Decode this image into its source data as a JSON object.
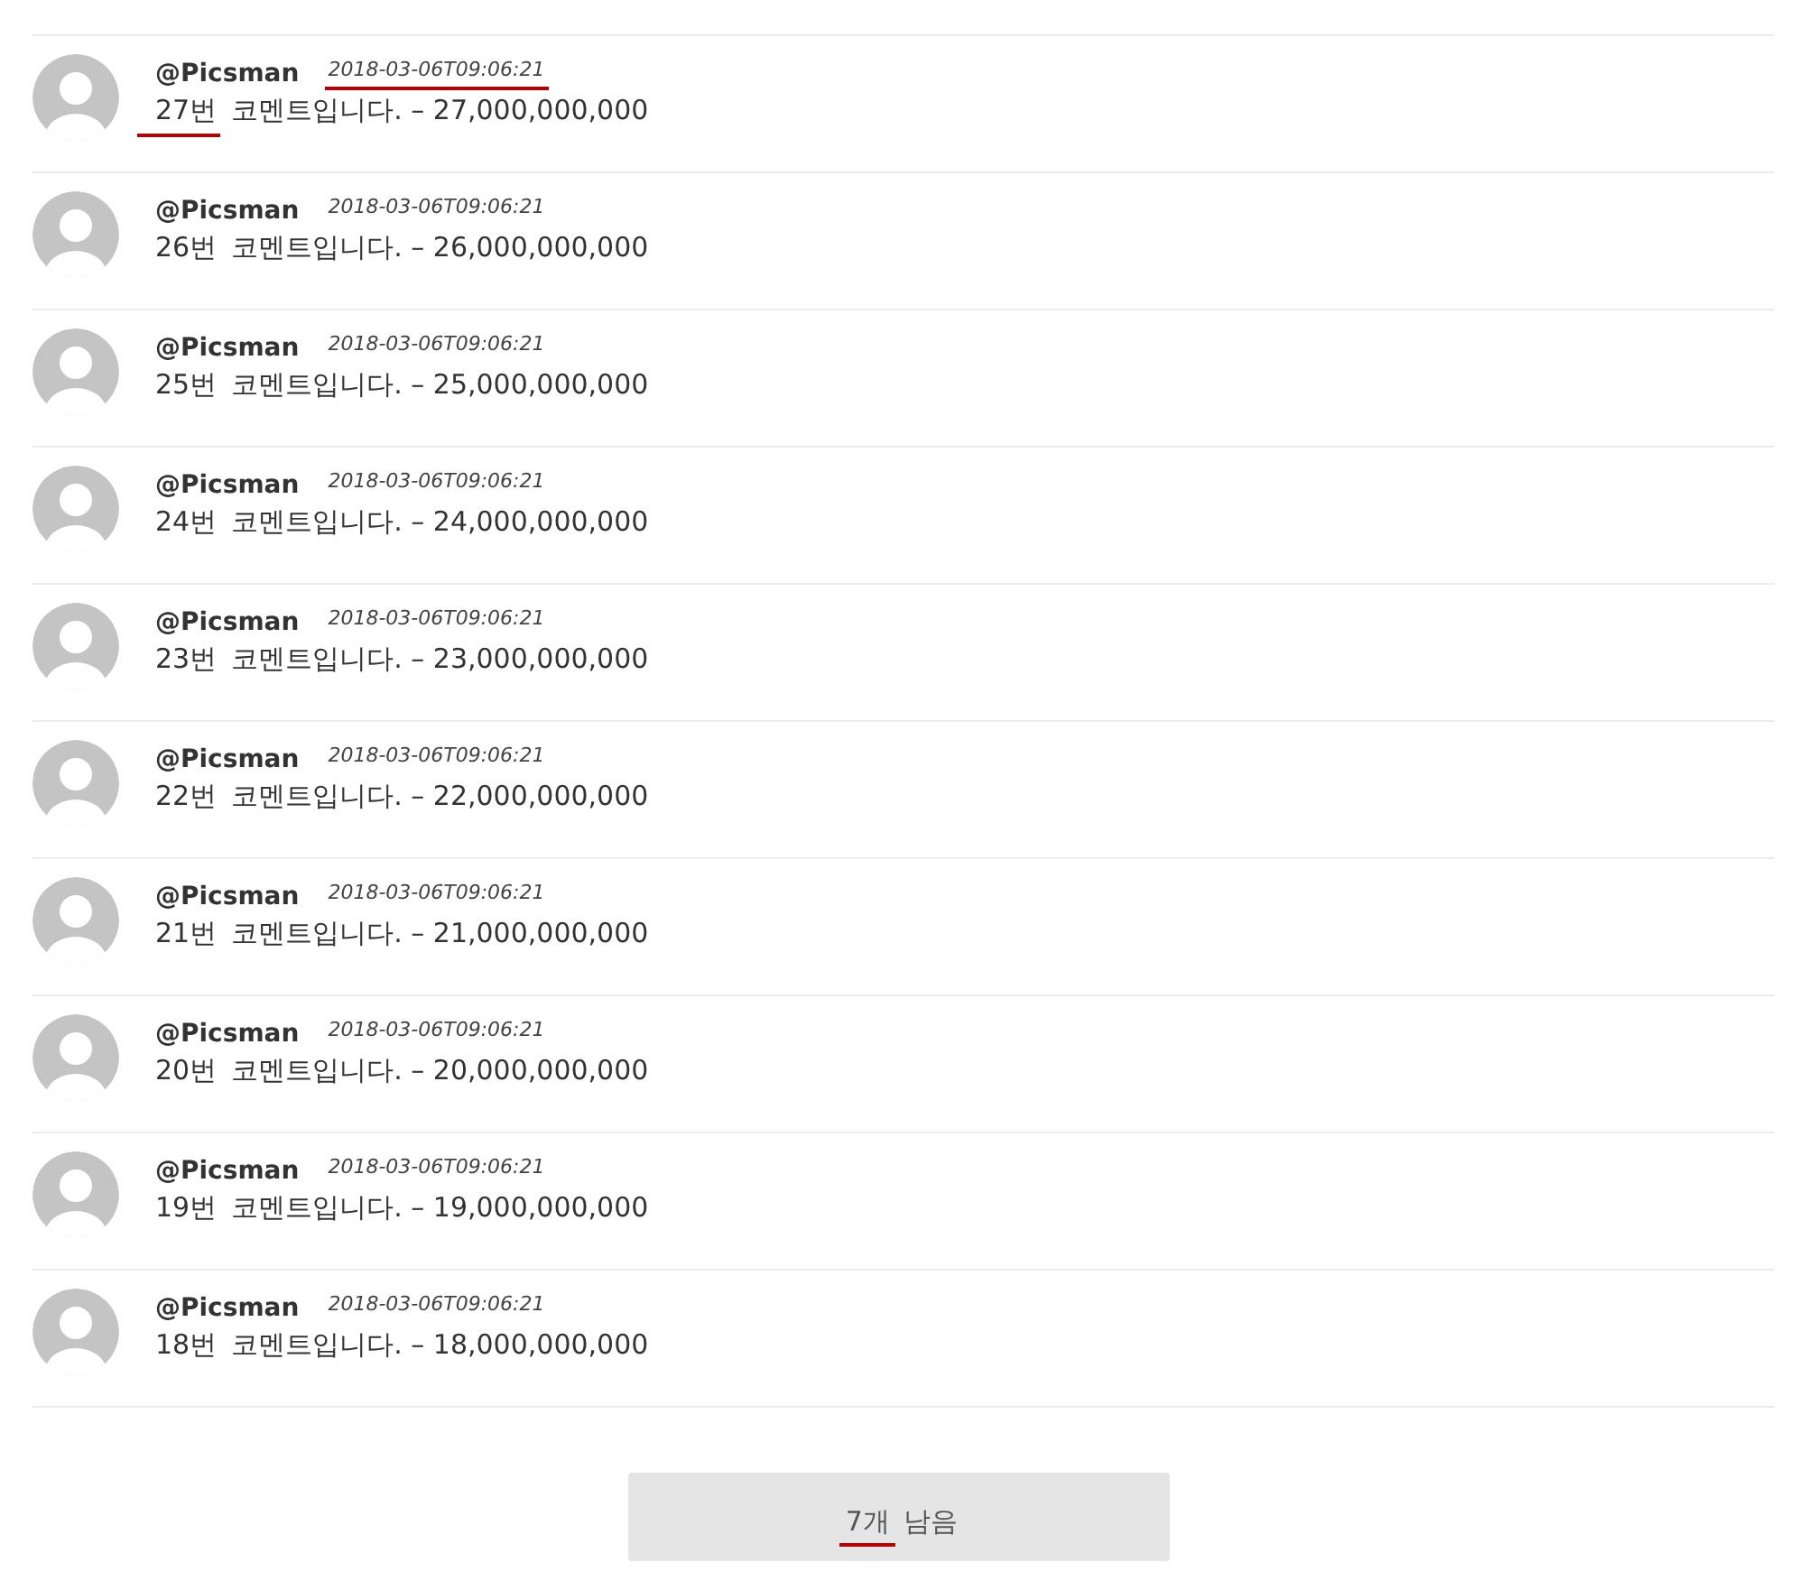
{
  "comments": [
    {
      "author": "@Picsman",
      "date": "2018-03-06T09:06:21",
      "date_underlined": true,
      "number": "27번",
      "number_underlined": true,
      "text": "코멘트입니다. – 27,000,000,000"
    },
    {
      "author": "@Picsman",
      "date": "2018-03-06T09:06:21",
      "date_underlined": false,
      "number": "26번",
      "number_underlined": false,
      "text": "코멘트입니다. – 26,000,000,000"
    },
    {
      "author": "@Picsman",
      "date": "2018-03-06T09:06:21",
      "date_underlined": false,
      "number": "25번",
      "number_underlined": false,
      "text": "코멘트입니다. – 25,000,000,000"
    },
    {
      "author": "@Picsman",
      "date": "2018-03-06T09:06:21",
      "date_underlined": false,
      "number": "24번",
      "number_underlined": false,
      "text": "코멘트입니다. – 24,000,000,000"
    },
    {
      "author": "@Picsman",
      "date": "2018-03-06T09:06:21",
      "date_underlined": false,
      "number": "23번",
      "number_underlined": false,
      "text": "코멘트입니다. – 23,000,000,000"
    },
    {
      "author": "@Picsman",
      "date": "2018-03-06T09:06:21",
      "date_underlined": false,
      "number": "22번",
      "number_underlined": false,
      "text": "코멘트입니다. – 22,000,000,000"
    },
    {
      "author": "@Picsman",
      "date": "2018-03-06T09:06:21",
      "date_underlined": false,
      "number": "21번",
      "number_underlined": false,
      "text": "코멘트입니다. – 21,000,000,000"
    },
    {
      "author": "@Picsman",
      "date": "2018-03-06T09:06:21",
      "date_underlined": false,
      "number": "20번",
      "number_underlined": false,
      "text": "코멘트입니다. – 20,000,000,000"
    },
    {
      "author": "@Picsman",
      "date": "2018-03-06T09:06:21",
      "date_underlined": false,
      "number": "19번",
      "number_underlined": false,
      "text": "코멘트입니다. – 19,000,000,000"
    },
    {
      "author": "@Picsman",
      "date": "2018-03-06T09:06:21",
      "date_underlined": false,
      "number": "18번",
      "number_underlined": false,
      "text": "코멘트입니다. – 18,000,000,000"
    }
  ],
  "more_button": {
    "count": "7개",
    "count_underlined": true,
    "label": "남음"
  }
}
